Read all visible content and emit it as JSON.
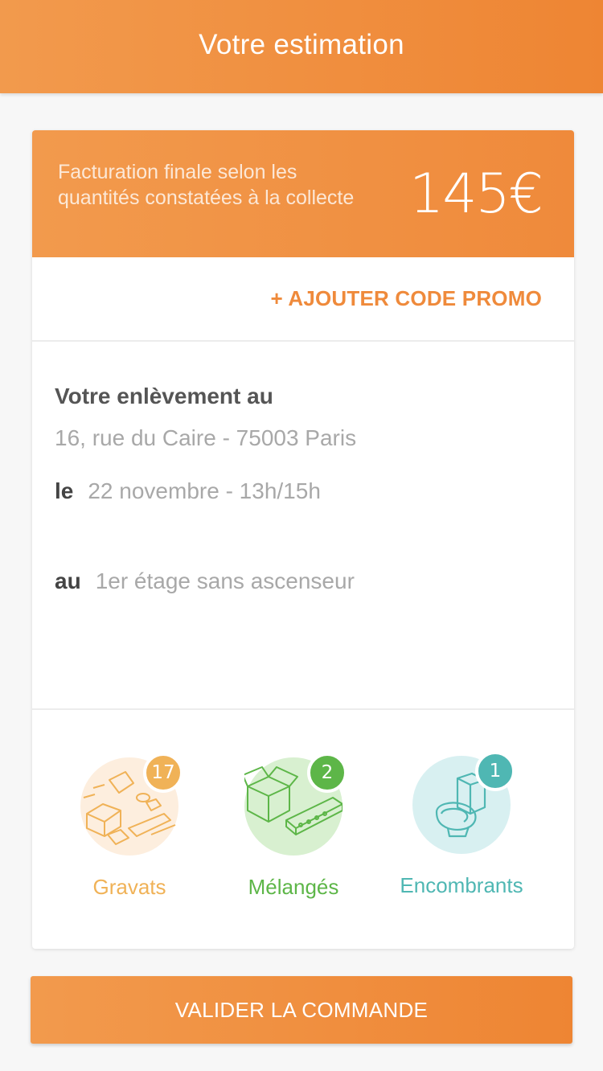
{
  "header": {
    "title": "Votre estimation"
  },
  "estimate": {
    "note": "Facturation finale selon les quantités constatées à la collecte",
    "price": "145€"
  },
  "promo": {
    "label": "+ AJOUTER CODE PROMO"
  },
  "pickup": {
    "title": "Votre enlèvement au",
    "address": "16, rue du Caire - 75003 Paris",
    "date_keyword": "le",
    "date_value": "22 novembre - 13h/15h",
    "floor_keyword": "au",
    "floor_value": "1er étage sans ascenseur"
  },
  "waste_types": [
    {
      "label": "Gravats",
      "count": "17",
      "icon": "rubble-icon",
      "color": "#f0b257",
      "bg": "#fdeede"
    },
    {
      "label": "Mélangés",
      "count": "2",
      "icon": "mixed-waste-icon",
      "color": "#5db648",
      "bg": "#d8f0d0"
    },
    {
      "label": "Encombrants",
      "count": "1",
      "icon": "toilet-icon",
      "color": "#4fb7b3",
      "bg": "#d8f0f1"
    }
  ],
  "actions": {
    "validate_label": "VALIDER LA COMMANDE"
  },
  "colors": {
    "accent": "#ef8a3b",
    "background": "#f7f7f7"
  }
}
